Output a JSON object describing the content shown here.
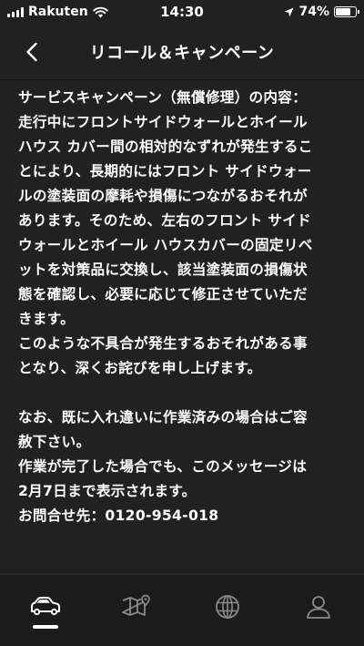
{
  "status_bar": {
    "carrier": "Rakuten",
    "time": "14:30",
    "battery": "74%",
    "battery_level": 0.74
  },
  "header": {
    "title": "リコール＆キャンペーン",
    "back_icon": "chevron-left-icon"
  },
  "body": {
    "paragraph_1": [
      "サービスキャンペーン（無償修理）の内容：",
      "走行中にフロントサイドウォールとホイール",
      "ハウス カバー間の相対的なずれが発生するこ",
      "とにより、長期的にはフロント サイドウォー",
      "ルの塗装面の摩耗や損傷につながるおそれが",
      "あります。そのため、左右のフロント サイド",
      "ウォールとホイール ハウスカバーの固定リベ",
      "ットを対策品に交換し、該当塗装面の損傷状",
      "態を確認し、必要に応じて修正させていただ",
      "きます。"
    ],
    "paragraph_2": [
      "このような不具合が発生するおそれがある事",
      "となり、深くお詫びを申し上げます。"
    ],
    "paragraph_3": [
      "なお、既に入れ違いに作業済みの場合はご容",
      "赦下さい。"
    ],
    "paragraph_4": [
      "作業が完了した場合でも、このメッセージは",
      "2月7日まで表示されます。"
    ],
    "contact": "お問合せ先：0120-954-018"
  },
  "tab_bar": {
    "tabs": [
      {
        "icon": "car-icon",
        "active": true
      },
      {
        "icon": "map-icon",
        "active": false
      },
      {
        "icon": "globe-icon",
        "active": false
      },
      {
        "icon": "profile-icon",
        "active": false
      }
    ],
    "active_color": "#ffffff",
    "inactive_color": "#8a8a8a"
  }
}
